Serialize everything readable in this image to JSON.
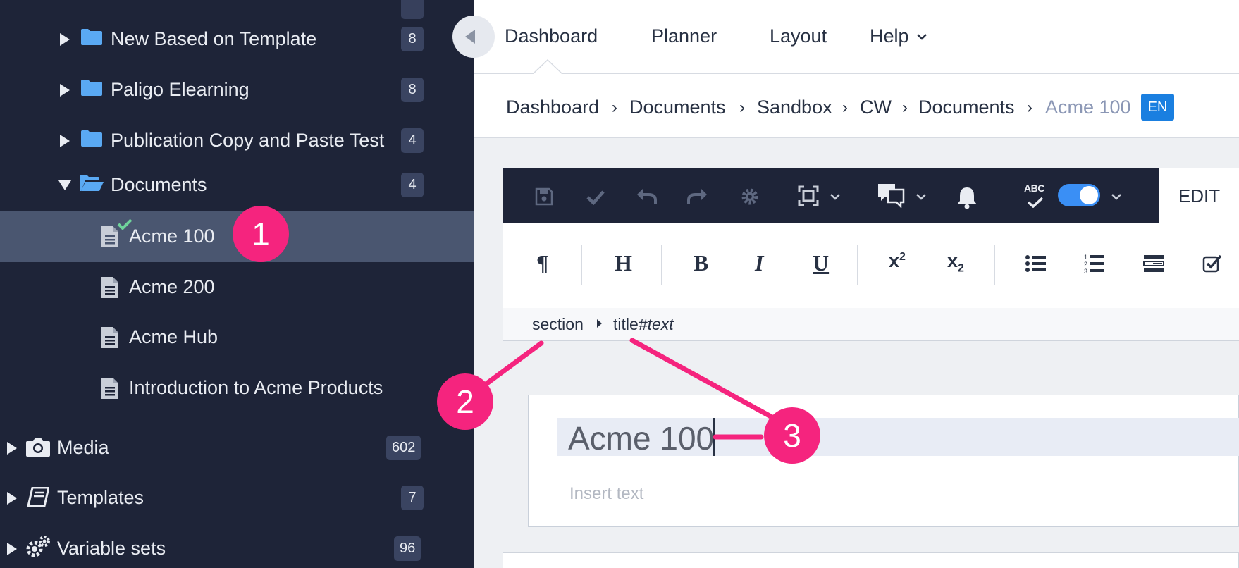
{
  "sidebar": {
    "tree": [
      {
        "label": "New Based on Template",
        "count": "8"
      },
      {
        "label": "Paligo Elearning",
        "count": "8"
      },
      {
        "label": "Publication Copy and Paste Test",
        "count": "4"
      },
      {
        "label": "Documents",
        "count": "4"
      },
      {
        "label": "Acme 100"
      },
      {
        "label": "Acme 200"
      },
      {
        "label": "Acme Hub"
      },
      {
        "label": "Introduction to Acme Products"
      },
      {
        "label": "Media",
        "count": "602"
      },
      {
        "label": "Templates",
        "count": "7"
      },
      {
        "label": "Variable sets",
        "count": "96"
      }
    ]
  },
  "nav": {
    "tabs": [
      "Dashboard",
      "Planner",
      "Layout",
      "Help"
    ]
  },
  "breadcrumb": {
    "items": [
      "Dashboard",
      "Documents",
      "Sandbox",
      "CW",
      "Documents"
    ],
    "current": "Acme 100",
    "lang": "EN"
  },
  "editor": {
    "toolbar": {
      "icons": [
        "save-icon",
        "check-icon",
        "undo-icon",
        "redo-icon",
        "gear-icon",
        "fullscreen-icon",
        "comments-icon",
        "bell-icon",
        "spellcheck-icon"
      ],
      "spellcheck_label": "ABC",
      "spellcheck_enabled": true,
      "edit_tab": "EDIT"
    },
    "format": {
      "paragraph": "¶",
      "heading": "H",
      "bold": "B",
      "italic": "I",
      "underline": "U",
      "superscript": "x",
      "sup_mark": "2",
      "subscript": "x",
      "sub_mark": "2"
    },
    "path": {
      "element": "section",
      "child": "title",
      "hash": "#",
      "node": "text"
    },
    "content": {
      "title": "Acme 100",
      "placeholder": "Insert text"
    }
  },
  "annotations": [
    "1",
    "2",
    "3"
  ],
  "colors": {
    "sidebar_bg": "#1e2438",
    "selected_bg": "#4a5670",
    "folder": "#5aa9f3",
    "accent": "#1a7fe0",
    "marker": "#f5247e",
    "toggle": "#3a8ff5",
    "status_check": "#6fd29b"
  }
}
